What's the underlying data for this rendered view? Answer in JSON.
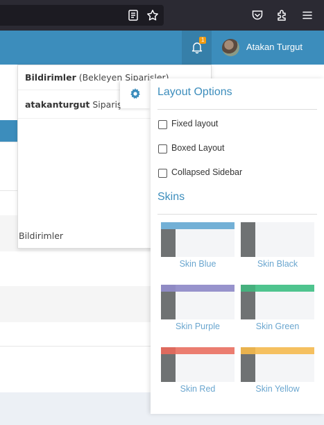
{
  "browser": {
    "icons": [
      "reader-view-icon",
      "bookmark-star-icon",
      "pocket-icon",
      "extensions-icon",
      "menu-icon"
    ]
  },
  "header": {
    "notification_count": "1",
    "user_name": "Atakan Turgut",
    "accent_color": "#3c8dbc"
  },
  "notifications": {
    "title_bold": "Bildirimler",
    "title_rest": " (Bekleyen Siparişler)",
    "item_user": "atakanturgut",
    "item_text": " Sipariş Be",
    "footer": "Bildirimler"
  },
  "control_sidebar": {
    "layout_title": "Layout Options",
    "options": [
      {
        "label": "Fixed layout",
        "checked": false
      },
      {
        "label": "Boxed Layout",
        "checked": false
      },
      {
        "label": "Collapsed Sidebar",
        "checked": false
      }
    ],
    "skins_title": "Skins",
    "skins": [
      {
        "label": "Skin Blue",
        "color": "#73b0d6",
        "logo_color": "#73b0d6",
        "side": "#6f7273"
      },
      {
        "label": "Skin Black",
        "color": "#f4f5f7",
        "logo_color": "#fefefe",
        "side": "#6f7273"
      },
      {
        "label": "Skin Purple",
        "color": "#9793cc",
        "logo_color": "#8f8ac4",
        "side": "#6f7273"
      },
      {
        "label": "Skin Green",
        "color": "#4fc48e",
        "logo_color": "#46b07e",
        "side": "#6f7273"
      },
      {
        "label": "Skin Red",
        "color": "#eb7d70",
        "logo_color": "#de6a5e",
        "side": "#6f7273"
      },
      {
        "label": "Skin Yellow",
        "color": "#f5c060",
        "logo_color": "#e9b24e",
        "side": "#6f7273"
      }
    ]
  }
}
